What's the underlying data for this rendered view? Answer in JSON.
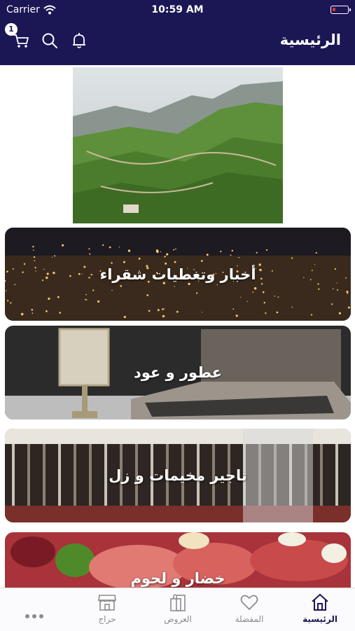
{
  "status_bar": {
    "carrier": "Carrier",
    "time": "10:59 AM",
    "battery_level": 0.2
  },
  "header": {
    "title": "الرئيسية",
    "cart_count": "1"
  },
  "hero": {
    "alt": "mountain-valley-photo"
  },
  "categories": [
    {
      "label": "أخبار وتغطيات شقراء",
      "image": "city-night-photo"
    },
    {
      "label": "عطور و عود",
      "image": "incense-oud-photo"
    },
    {
      "label": "تاجير مخيمات و زل",
      "image": "tent-interior-photo"
    },
    {
      "label": "خضار و لحوم",
      "image": "meat-vegetables-photo"
    }
  ],
  "tabs": [
    {
      "label": "الرئيسية",
      "icon": "home-icon",
      "active": true
    },
    {
      "label": "المفضلة",
      "icon": "heart-icon",
      "active": false
    },
    {
      "label": "العروض",
      "icon": "offers-icon",
      "active": false
    },
    {
      "label": "حراج",
      "icon": "store-icon",
      "active": false
    },
    {
      "label": "",
      "icon": "more-icon",
      "active": false
    }
  ],
  "colors": {
    "header_bg": "#1b1654",
    "active_tab": "#1b1654",
    "inactive_tab": "#8c8c8c"
  }
}
